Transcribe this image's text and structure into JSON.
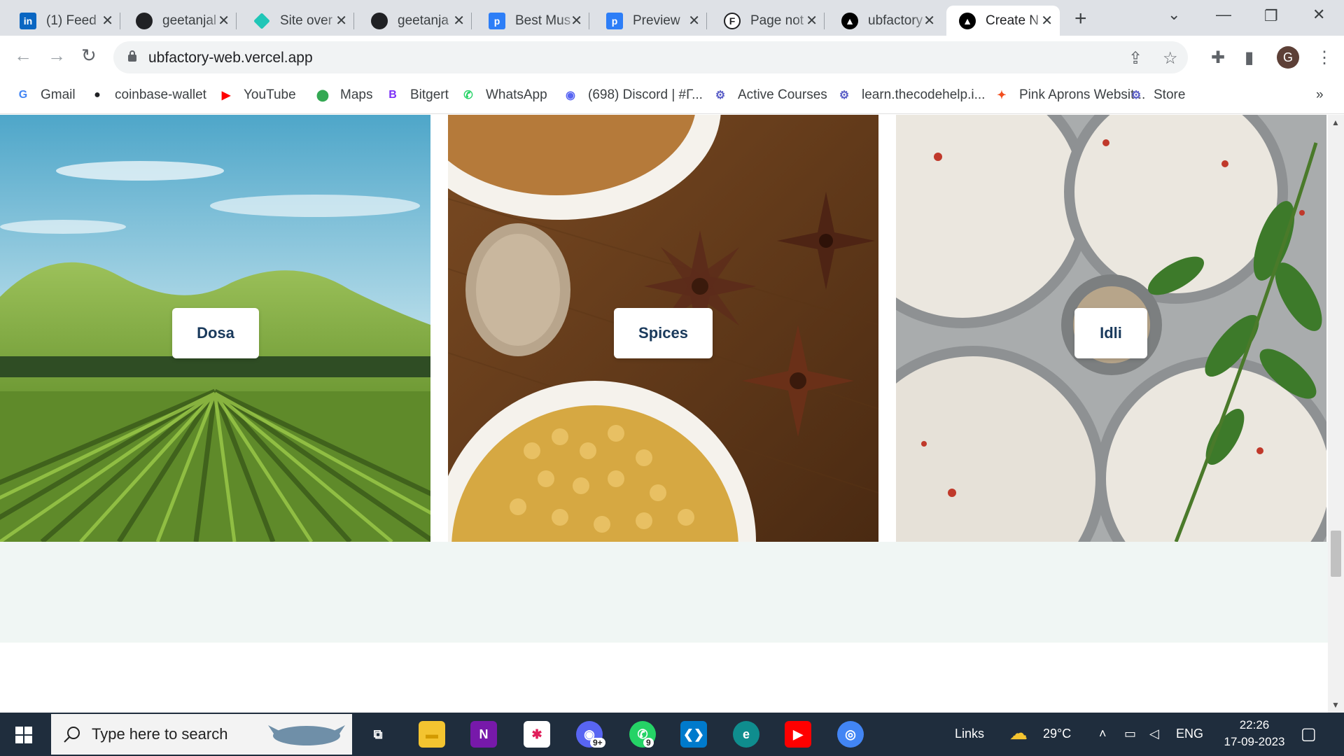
{
  "tabs": [
    {
      "title": "(1) Feed",
      "icon": "linkedin-icon",
      "glyph": "in",
      "color": "#0a66c2",
      "fg": "#ffffff"
    },
    {
      "title": "geetanjal",
      "icon": "github-icon",
      "glyph": "",
      "color": "#202124",
      "fg": "#ffffff"
    },
    {
      "title": "Site over",
      "icon": "netlify-icon",
      "glyph": "",
      "color": "#20c6b7",
      "fg": "#ffffff"
    },
    {
      "title": "geetanja",
      "icon": "github-icon",
      "glyph": "",
      "color": "#202124",
      "fg": "#ffffff"
    },
    {
      "title": "Best Mus",
      "icon": "p-app-icon",
      "glyph": "p",
      "color": "#2d7ef7",
      "fg": "#ffffff"
    },
    {
      "title": "Preview",
      "icon": "p-app-icon",
      "glyph": "p",
      "color": "#2d7ef7",
      "fg": "#ffffff"
    },
    {
      "title": "Page not",
      "icon": "f-circle-icon",
      "glyph": "F",
      "color": "#ffffff",
      "fg": "#202124"
    },
    {
      "title": "ubfactory",
      "icon": "vercel-icon",
      "glyph": "▲",
      "color": "#000000",
      "fg": "#ffffff"
    },
    {
      "title": "Create N",
      "icon": "vercel-icon",
      "glyph": "▲",
      "color": "#000000",
      "fg": "#ffffff"
    }
  ],
  "address": {
    "url": "ubfactory-web.vercel.app"
  },
  "profile": {
    "initial": "G"
  },
  "bookmarks": [
    {
      "label": "Gmail",
      "icon": "google-icon",
      "glyph": "G",
      "color": "#4285f4"
    },
    {
      "label": "coinbase-wallet",
      "icon": "github-icon",
      "glyph": "●",
      "color": "#202124"
    },
    {
      "label": "YouTube",
      "icon": "youtube-icon",
      "glyph": "▶",
      "color": "#ff0000"
    },
    {
      "label": "Maps",
      "icon": "maps-icon",
      "glyph": "⬤",
      "color": "#34a853"
    },
    {
      "label": "Bitgert",
      "icon": "bitgert-icon",
      "glyph": "B",
      "color": "#7b2ff7"
    },
    {
      "label": "WhatsApp",
      "icon": "whatsapp-icon",
      "glyph": "✆",
      "color": "#25d366"
    },
    {
      "label": "(698) Discord | #Г...",
      "icon": "discord-icon",
      "glyph": "◉",
      "color": "#5865f2"
    },
    {
      "label": "Active Courses",
      "icon": "codehelp-icon",
      "glyph": "⚙",
      "color": "#5b5fc7"
    },
    {
      "label": "learn.thecodehelp.i...",
      "icon": "codehelp-icon",
      "glyph": "⚙",
      "color": "#5b5fc7"
    },
    {
      "label": "Pink Aprons Websit...",
      "icon": "figma-icon",
      "glyph": "✦",
      "color": "#f24e1e"
    },
    {
      "label": "Store",
      "icon": "codehelp-icon",
      "glyph": "⚙",
      "color": "#5b5fc7"
    }
  ],
  "cards": [
    {
      "label": "Dosa",
      "scene": "farm-field"
    },
    {
      "label": "Spices",
      "scene": "spices-bowls"
    },
    {
      "label": "Idli",
      "scene": "idli-plate"
    }
  ],
  "taskbar": {
    "search_placeholder": "Type here to search",
    "links_label": "Links",
    "temperature": "29°C",
    "language": "ENG",
    "time": "22:26",
    "date": "17-09-2023",
    "whatsapp_badge": "9",
    "discord_badge": "9+",
    "apps": [
      {
        "name": "task-view-icon",
        "glyph": "⧉",
        "bg": "transparent",
        "fg": "#ffffff"
      },
      {
        "name": "file-explorer-icon",
        "glyph": "▬",
        "bg": "#f4c430",
        "fg": "#d39a00"
      },
      {
        "name": "onenote-icon",
        "glyph": "N",
        "bg": "#7719aa",
        "fg": "#ffffff"
      },
      {
        "name": "slack-icon",
        "glyph": "✱",
        "bg": "#ffffff",
        "fg": "#e01e5a"
      },
      {
        "name": "discord-icon",
        "glyph": "◉",
        "bg": "#5865f2",
        "fg": "#ffffff"
      },
      {
        "name": "whatsapp-icon",
        "glyph": "✆",
        "bg": "#25d366",
        "fg": "#ffffff"
      },
      {
        "name": "vscode-icon",
        "glyph": "❮❯",
        "bg": "#007acc",
        "fg": "#ffffff"
      },
      {
        "name": "edge-icon",
        "glyph": "e",
        "bg": "#0f8d8e",
        "fg": "#ffffff"
      },
      {
        "name": "youtube-icon",
        "glyph": "▶",
        "bg": "#ff0000",
        "fg": "#ffffff"
      },
      {
        "name": "chrome-icon",
        "glyph": "◎",
        "bg": "#4285f4",
        "fg": "#ffffff"
      }
    ]
  }
}
